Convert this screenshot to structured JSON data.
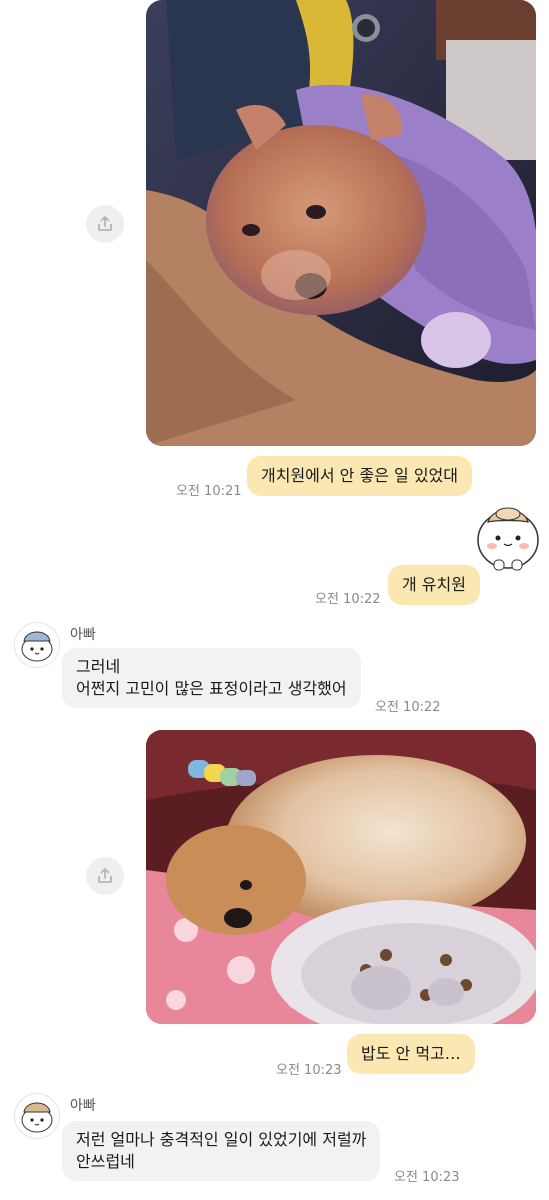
{
  "messages": {
    "m1_time": "오전 10:21",
    "m1_text": "개치원에서 안 좋은 일 있었대",
    "m2_time": "오전 10:22",
    "m2_text": "개 유치원",
    "m3_sender": "아빠",
    "m3_line1": "그러네",
    "m3_line2": "어쩐지 고민이 많은 표정이라고 생각했어",
    "m3_time": "오전 10:22",
    "m4_time": "오전 10:23",
    "m4_text": "밥도 안 먹고…",
    "m5_sender": "아빠",
    "m5_line1": "저런 얼마나 충격적인 일이 있었기에 저럴까",
    "m5_line2": "안쓰럽네",
    "m5_time": "오전 10:23"
  },
  "colors": {
    "my_bubble": "#fbe7b2",
    "other_bubble": "#f2f2f2",
    "share_button": "#efefef"
  },
  "icons": {
    "share": "share-icon",
    "avatar": "hamster-avatar-icon",
    "sticker": "hamster-sticker"
  }
}
